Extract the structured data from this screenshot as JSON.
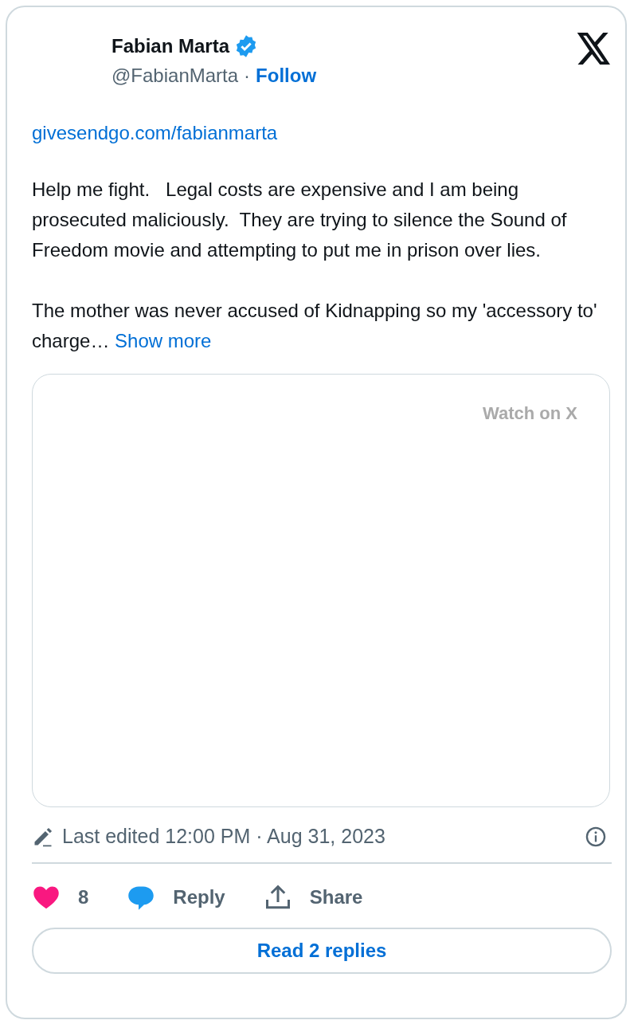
{
  "author": {
    "name": "Fabian Marta",
    "verified": true,
    "handle": "@FabianMarta",
    "separator": "·",
    "follow": "Follow"
  },
  "link": "givesendgo.com/fabianmarta",
  "paragraphs": [
    "Help me fight.   Legal costs are expensive and I am being prosecuted maliciously.  They are trying to silence the Sound of Freedom movie and attempting to put me in prison over lies.",
    "The mother was never accused of Kidnapping so my 'accessory to' charge…"
  ],
  "show_more": "Show more",
  "media": {
    "watch": "Watch on X"
  },
  "edited": "Last edited 12:00 PM · Aug 31, 2023",
  "actions": [
    {
      "kind": "like",
      "label": "8"
    },
    {
      "kind": "reply",
      "label": "Reply"
    },
    {
      "kind": "share",
      "label": "Share"
    }
  ],
  "read_replies": "Read 2 replies"
}
